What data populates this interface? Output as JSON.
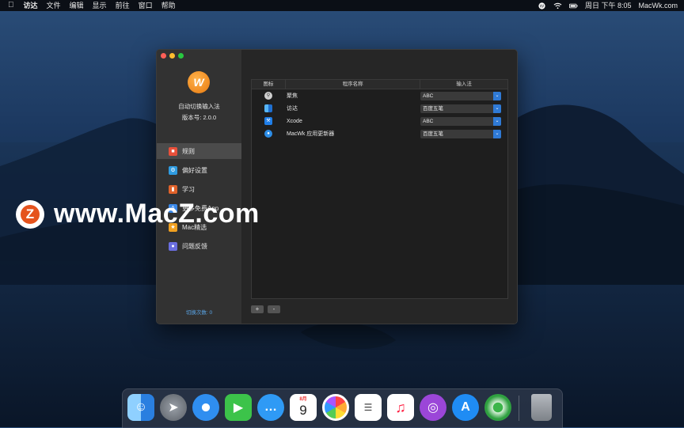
{
  "menubar": {
    "app_name": "访达",
    "menus": [
      "文件",
      "编辑",
      "显示",
      "前往",
      "窗口",
      "帮助"
    ],
    "datetime": "周日 下午 8:05",
    "site": "MacWk.com"
  },
  "watermark": {
    "badge": "Z",
    "text": "www.MacZ.com"
  },
  "window": {
    "app_title": "自动切换输入法",
    "version": "版本号: 2.0.0",
    "nav": [
      {
        "label": "规则",
        "icon": "rules-icon",
        "color": "#e8503a"
      },
      {
        "label": "偏好设置",
        "icon": "gear-icon",
        "color": "#2f9be0"
      },
      {
        "label": "学习",
        "icon": "book-icon",
        "color": "#e0622a"
      },
      {
        "label": "更多免费App",
        "icon": "appstore-icon",
        "color": "#3a88e8"
      },
      {
        "label": "Mac精选",
        "icon": "star-icon",
        "color": "#f0a020"
      },
      {
        "label": "问题反馈",
        "icon": "feedback-icon",
        "color": "#6a6ee0"
      }
    ],
    "switch_count": "切换次数: 0",
    "table": {
      "headers": [
        "图标",
        "程序名称",
        "输入法"
      ],
      "rows": [
        {
          "name": "聚焦",
          "input": "ABC",
          "icon": "spotlight-icon"
        },
        {
          "name": "访达",
          "input": "百度五笔",
          "icon": "finder-icon"
        },
        {
          "name": "Xcode",
          "input": "ABC",
          "icon": "xcode-icon"
        },
        {
          "name": "MacWk 应用更新器",
          "input": "百度五笔",
          "icon": "updater-icon"
        }
      ]
    },
    "add_label": "+",
    "remove_label": "-"
  },
  "dock": {
    "calendar_month": "8月",
    "calendar_day": "9",
    "apps": [
      "Finder",
      "Launchpad",
      "Safari",
      "FaceTime",
      "Messages",
      "Calendar",
      "Photos",
      "Reminders",
      "Music",
      "Podcasts",
      "App Store",
      "Find My"
    ]
  }
}
